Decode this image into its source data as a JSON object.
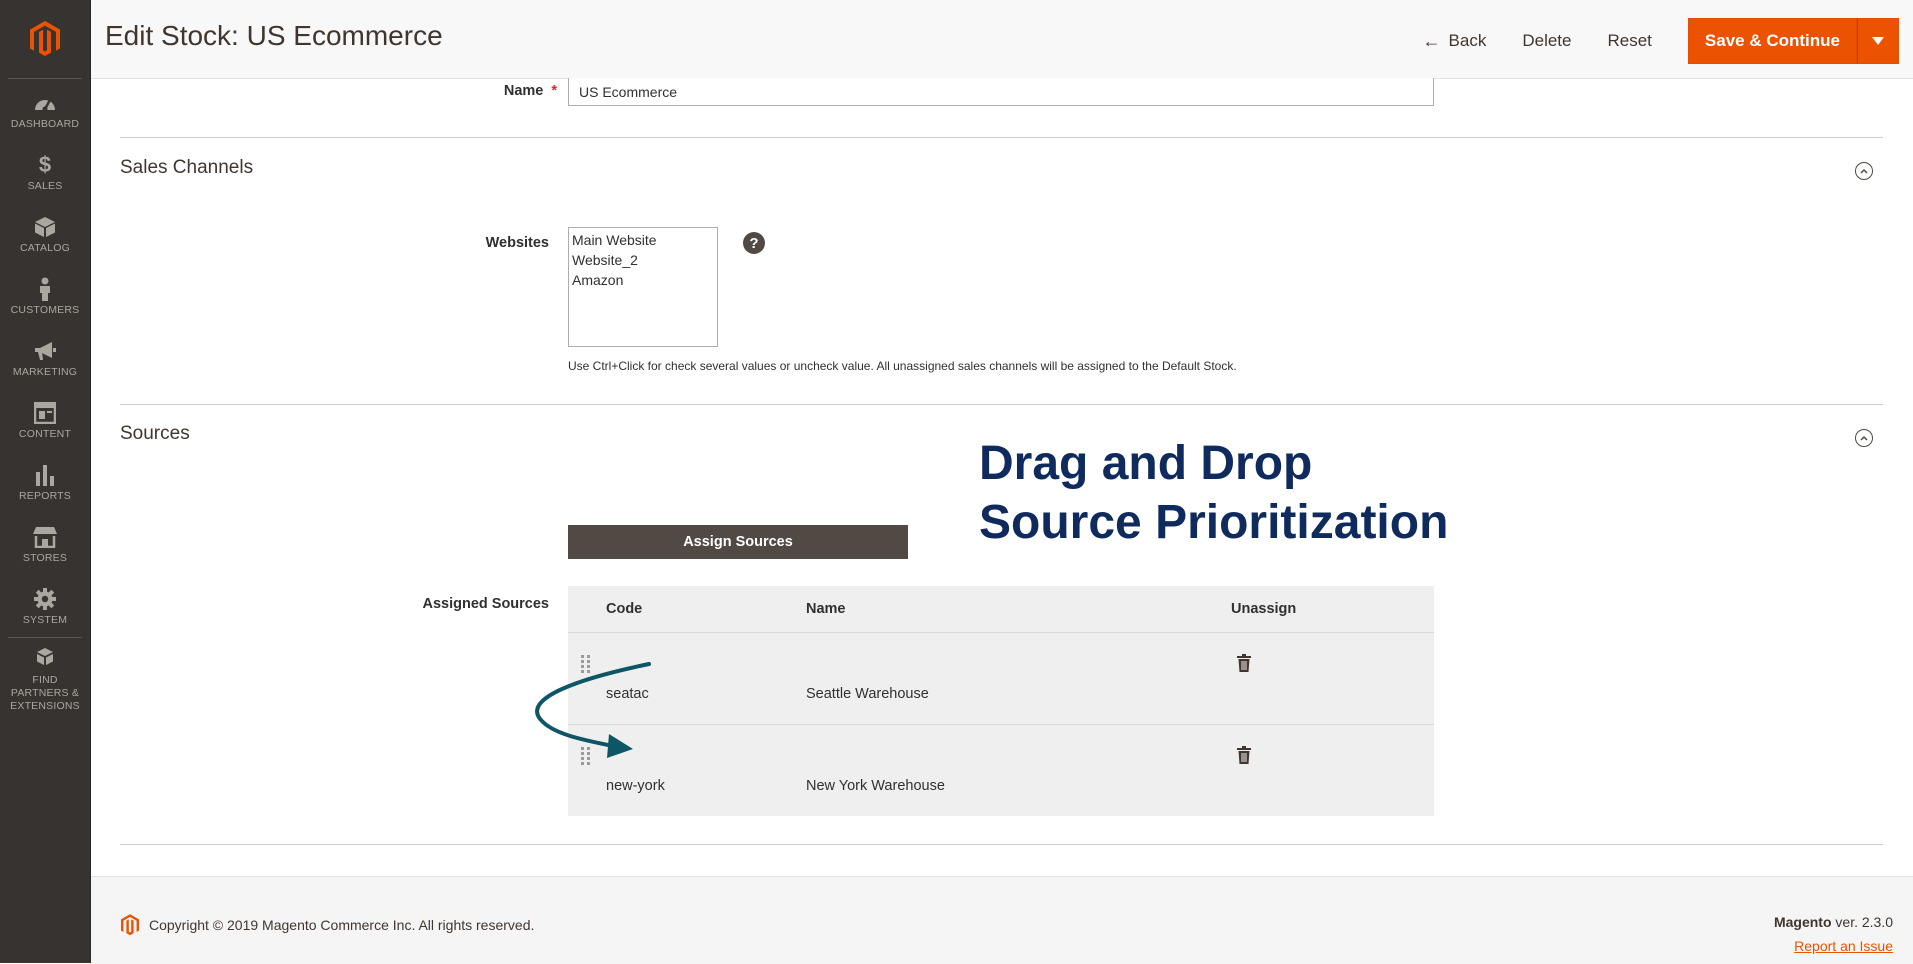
{
  "sidebar": {
    "logo": "magento-logo",
    "items": [
      {
        "label": "DASHBOARD",
        "icon": "dashboard-icon"
      },
      {
        "label": "SALES",
        "icon": "dollar-icon"
      },
      {
        "label": "CATALOG",
        "icon": "box-icon"
      },
      {
        "label": "CUSTOMERS",
        "icon": "person-icon"
      },
      {
        "label": "MARKETING",
        "icon": "megaphone-icon"
      },
      {
        "label": "CONTENT",
        "icon": "layout-icon"
      },
      {
        "label": "REPORTS",
        "icon": "bar-chart-icon"
      },
      {
        "label": "STORES",
        "icon": "storefront-icon"
      },
      {
        "label": "SYSTEM",
        "icon": "gear-icon"
      },
      {
        "label": "FIND PARTNERS & EXTENSIONS",
        "icon": "cubes-icon"
      }
    ]
  },
  "header": {
    "title": "Edit Stock: US Ecommerce",
    "back_label": "Back",
    "delete_label": "Delete",
    "reset_label": "Reset",
    "save_label": "Save & Continue"
  },
  "form": {
    "name_label": "Name",
    "name_value": "US Ecommerce"
  },
  "sales_channels": {
    "title": "Sales Channels",
    "websites_label": "Websites",
    "options": [
      "Main Website",
      "Website_2",
      "Amazon"
    ],
    "note": "Use Ctrl+Click for check several values or uncheck value. All unassigned sales channels will be assigned to the Default Stock."
  },
  "sources": {
    "title": "Sources",
    "assign_button": "Assign Sources",
    "assigned_label": "Assigned Sources",
    "overlay_line1": "Drag and Drop",
    "overlay_line2": "Source Prioritization",
    "columns": {
      "code": "Code",
      "name": "Name",
      "unassign": "Unassign"
    },
    "rows": [
      {
        "code": "seatac",
        "name": "Seattle Warehouse"
      },
      {
        "code": "new-york",
        "name": "New York Warehouse"
      }
    ],
    "arrow_color": "#0e5566"
  },
  "footer": {
    "copyright": "Copyright © 2019 Magento Commerce Inc. All rights reserved.",
    "brand": "Magento",
    "version": " ver. 2.3.0",
    "report_link": "Report an Issue"
  },
  "colors": {
    "accent": "#eb5202",
    "sidebar_bg": "#373330",
    "dark_button": "#514943"
  }
}
